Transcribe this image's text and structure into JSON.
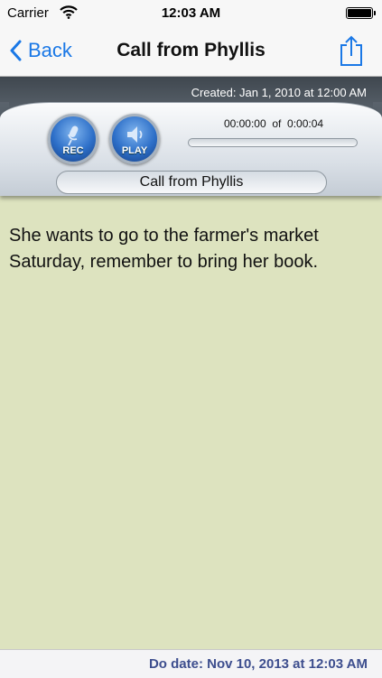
{
  "status_bar": {
    "carrier": "Carrier",
    "time": "12:03 AM",
    "battery_level": 1.0
  },
  "nav": {
    "back_label": "Back",
    "title": "Call from Phyllis",
    "share_icon": "share-icon",
    "accent_color": "#1a78e6"
  },
  "recorder": {
    "created_label": "Created: Jan 1, 2010 at 12:00 AM",
    "rec_label": "REC",
    "play_label": "PLAY",
    "position": "00:00:00",
    "of_label": "of",
    "duration": "0:00:04",
    "progress_fraction": 0,
    "name": "Call from Phyllis"
  },
  "note": {
    "body": "She wants to go to the farmer's market Saturday, remember to bring her book."
  },
  "footer": {
    "do_date": "Do date: Nov 10, 2013 at 12:03 AM"
  }
}
